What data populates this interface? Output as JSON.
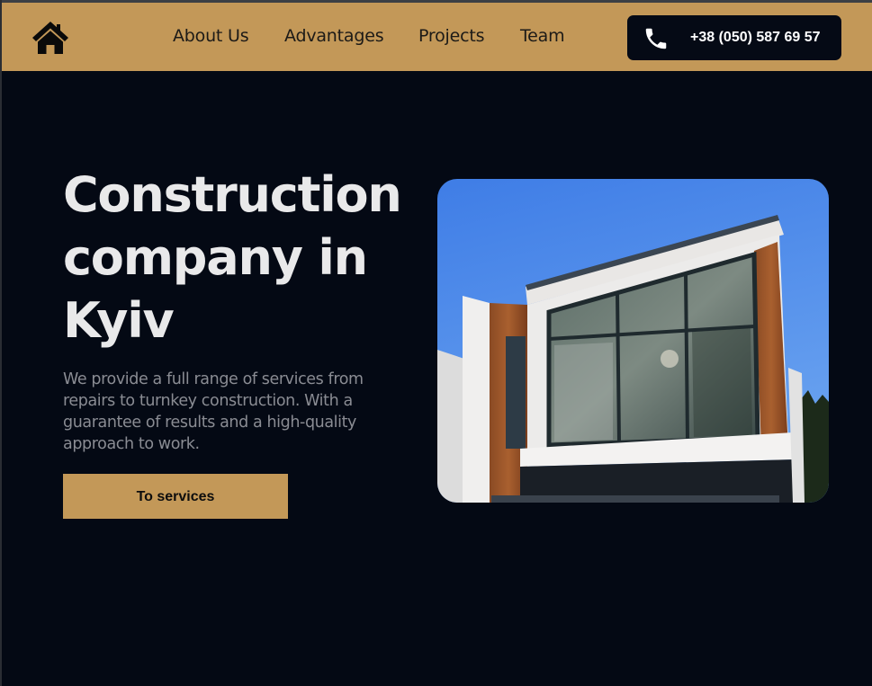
{
  "header": {
    "nav": [
      {
        "label": "About Us"
      },
      {
        "label": "Advantages"
      },
      {
        "label": "Projects"
      },
      {
        "label": "Team"
      }
    ],
    "phone": "+38 (050) 587 69 57"
  },
  "hero": {
    "title": "Construction company in Kyiv",
    "description": "We provide a full range of services from repairs to turnkey construction. With a guarantee of results and a high-quality approach to work.",
    "cta_label": "To services"
  },
  "icons": {
    "home": "home-icon",
    "phone": "phone-icon"
  },
  "colors": {
    "accent": "#c39858",
    "background": "#040914",
    "title": "#e9e9ea",
    "text_muted": "#8a8c93"
  }
}
